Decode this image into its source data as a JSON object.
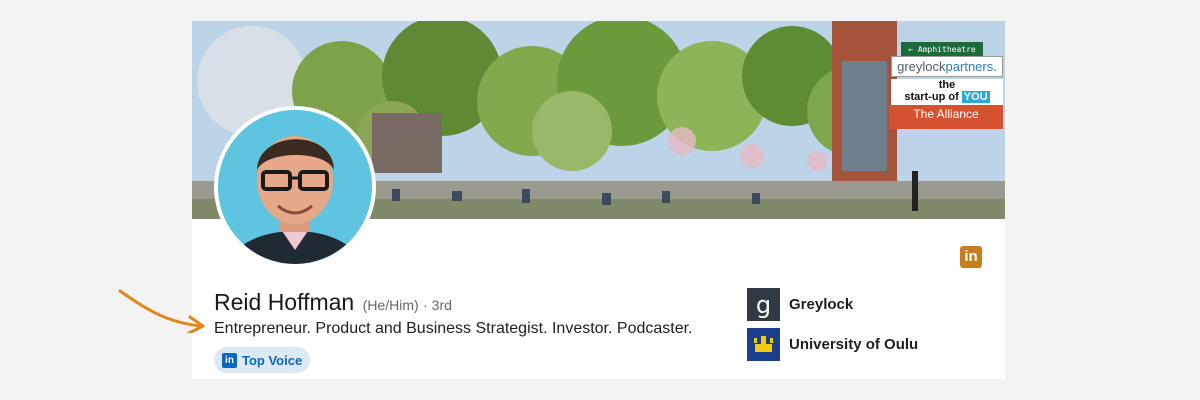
{
  "banner": {
    "greylock_text": "greylock",
    "greylock_accent": "partners.",
    "startup_line1": "the",
    "startup_line2": "start-up of",
    "startup_you": "YOU",
    "alliance": "The Alliance"
  },
  "profile": {
    "name": "Reid Hoffman",
    "pronouns": "(He/Him)",
    "degree": "· 3rd",
    "headline": "Entrepreneur. Product and Business Strategist. Investor. Podcaster.",
    "badge": "Top Voice"
  },
  "orgs": [
    {
      "name": "Greylock",
      "logo_letter": "g"
    },
    {
      "name": "University of Oulu"
    }
  ],
  "linkedin_badge": "in",
  "colors": {
    "page_bg": "#f3f3f3",
    "linkedin_blue": "#0a66c2",
    "linkedin_badge_orange": "#c77f1e",
    "annotation_arrow": "#e3861a",
    "top_voice_bg": "#dde9f5"
  },
  "icons": [
    "linkedin-icon",
    "greylock-logo-icon",
    "university-of-oulu-logo-icon",
    "annotation-arrow-icon"
  ]
}
